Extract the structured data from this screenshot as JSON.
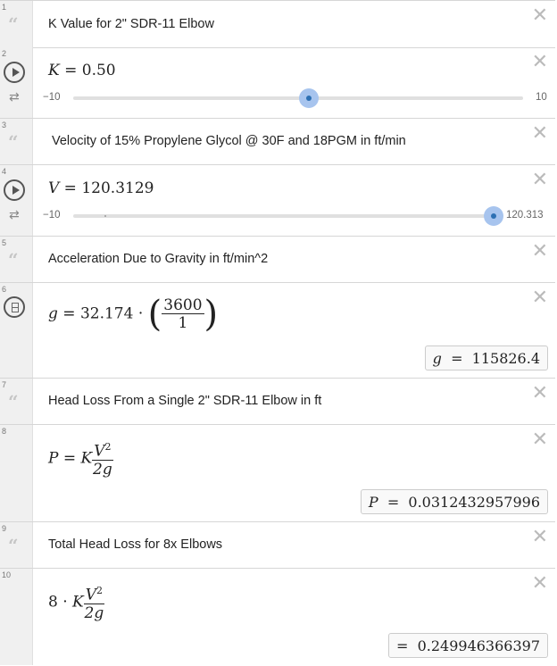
{
  "rows": {
    "r1": {
      "num": "1",
      "text": "K Value for 2\" SDR-11 Elbow"
    },
    "r2": {
      "num": "2",
      "lhs": "K",
      "eq": " = ",
      "value": "0.50",
      "min": "−10",
      "max": "10",
      "fraction": 0.525
    },
    "r3": {
      "num": "3",
      "text": "Velocity of 15% Propylene Glycol @ 30F and 18PGM in ft/min"
    },
    "r4": {
      "num": "4",
      "lhs": "V",
      "eq": " = ",
      "value": "120.3129",
      "min": "−10",
      "max": "120.313",
      "fraction": 1.0
    },
    "r5": {
      "num": "5",
      "text": "Acceleration Due to Gravity in ft/min^2"
    },
    "r6": {
      "num": "6",
      "lhs": "g",
      "expr": "32.174",
      "num_top": "3600",
      "num_bottom": "1",
      "result_lhs": "g",
      "result_val": "115826.4"
    },
    "r7": {
      "num": "7",
      "text": "Head Loss From a Single 2\" SDR-11 Elbow in ft"
    },
    "r8": {
      "num": "8",
      "lhs": "P",
      "k": "K",
      "top": "V",
      "top_exp": "2",
      "bottom": "2g",
      "result_lhs": "P",
      "result_val": "0.0312432957996"
    },
    "r9": {
      "num": "9",
      "text": "Total Head Loss for 8x Elbows"
    },
    "r10": {
      "num": "10",
      "coef": "8",
      "k": "K",
      "top": "V",
      "top_exp": "2",
      "bottom": "2g",
      "result_val": "0.249946366397"
    }
  },
  "icons": {
    "close": "close-icon",
    "note": "quote-icon",
    "play": "play-icon",
    "loop": "loop-icon",
    "table": "table-icon"
  },
  "colors": {
    "accent": "#2d70b3",
    "thumb_halo": "#a7c4ee"
  }
}
